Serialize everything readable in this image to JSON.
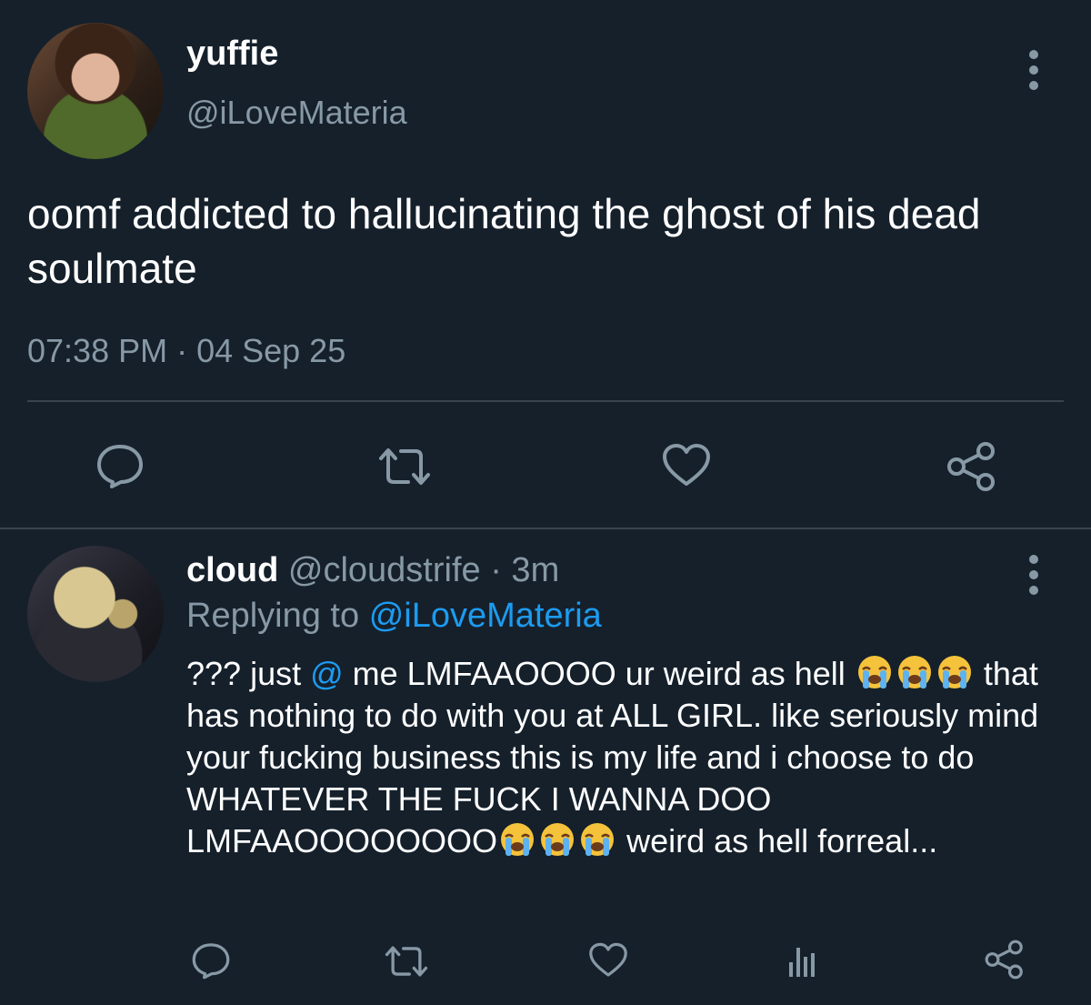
{
  "tweet": {
    "display_name": "yuffie",
    "handle": "@iLoveMateria",
    "text": "oomf addicted to hallucinating the ghost of his dead soulmate",
    "timestamp": "07:38 PM · 04 Sep 25",
    "avatar_icon": "avatar-yuffie",
    "actions": [
      "comment-icon",
      "retweet-icon",
      "like-icon",
      "share-icon"
    ]
  },
  "reply": {
    "display_name": "cloud",
    "handle": "@cloudstrife",
    "time": "· 3m",
    "replying_to_label": "Replying to",
    "replying_to_handle": "@iLoveMateria",
    "text_part1": "??? just ",
    "mention": "@",
    "text_part2": " me LMFAAOOOO ur weird as hell ",
    "text_part3": " that has nothing to do with you at ALL GIRL. like seriously mind your fucking business this is my life and i choose to do WHATEVER THE FUCK I WANNA DOO LMFAAOOOOOOOO",
    "text_part4": " weird as hell forreal...",
    "emoji_icon": "loudly-crying-face-icon",
    "actions": [
      "comment-icon",
      "retweet-icon",
      "like-icon",
      "analytics-icon",
      "share-icon"
    ]
  },
  "colors": {
    "background": "#15202b",
    "text": "#ffffff",
    "muted": "#8899a6",
    "link": "#1d9bf0",
    "divider": "#38444d"
  }
}
